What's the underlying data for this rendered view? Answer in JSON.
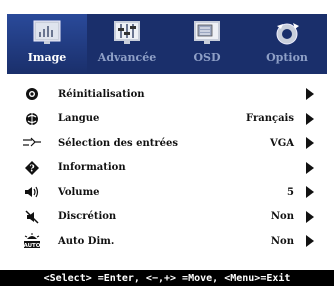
{
  "tabs": [
    {
      "label": "Image",
      "icon": "image-tab-icon",
      "active": true
    },
    {
      "label": "Advancée",
      "icon": "advanced-tab-icon",
      "active": false
    },
    {
      "label": "OSD",
      "icon": "osd-tab-icon",
      "active": false
    },
    {
      "label": "Option",
      "icon": "option-tab-icon",
      "active": false
    }
  ],
  "menu": {
    "items": [
      {
        "label": "Réinitialisation",
        "value": "",
        "icon": "reset-icon"
      },
      {
        "label": "Langue",
        "value": "Français",
        "icon": "language-icon"
      },
      {
        "label": "Sélection des entrées",
        "value": "VGA",
        "icon": "input-select-icon"
      },
      {
        "label": "Information",
        "value": "",
        "icon": "information-icon"
      },
      {
        "label": "Volume",
        "value": "5",
        "icon": "volume-icon"
      },
      {
        "label": "Discrétion",
        "value": "Non",
        "icon": "mute-icon"
      },
      {
        "label": "Auto Dim.",
        "value": "Non",
        "icon": "auto-dim-icon"
      }
    ]
  },
  "footer": {
    "hint": "<Select> =Enter, <−,+> =Move, <Menu>=Exit"
  },
  "colors": {
    "tab_bar": "#1a2f6b",
    "active_tab_label": "#ffffff",
    "inactive_tab_label": "#8fa0c7",
    "footer_bg": "#000000"
  }
}
